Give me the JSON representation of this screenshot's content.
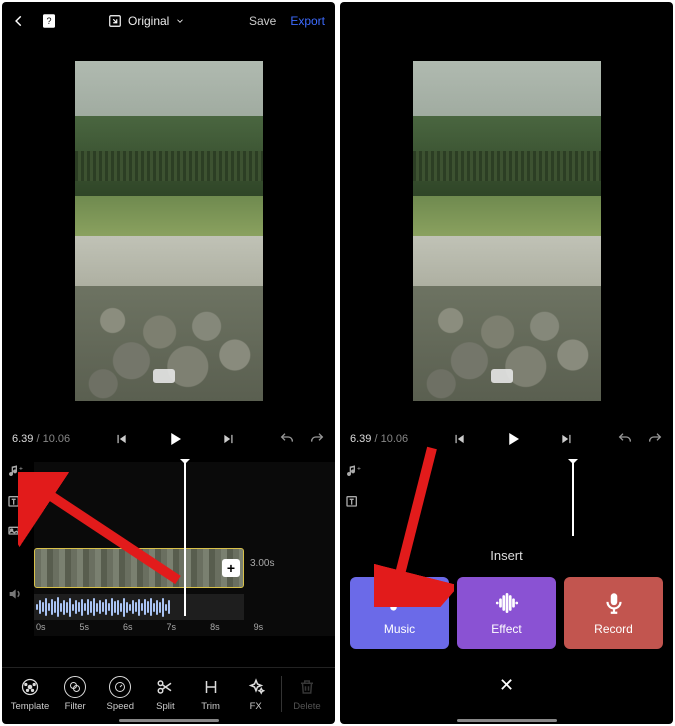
{
  "left": {
    "topbar": {
      "ratio_label": "Original",
      "save": "Save",
      "export": "Export"
    },
    "transport": {
      "current": "6.39",
      "total": "10.06"
    },
    "clip": {
      "duration": "3.00s",
      "add_label": "+"
    },
    "ruler": [
      "0s",
      "5s",
      "6s",
      "7s",
      "8s",
      "9s"
    ],
    "toolbar": {
      "template": "Template",
      "filter": "Filter",
      "speed": "Speed",
      "split": "Split",
      "trim": "Trim",
      "fx": "FX",
      "delete": "Delete"
    }
  },
  "right": {
    "transport": {
      "current": "6.39",
      "total": "10.06"
    },
    "insert": {
      "header": "Insert",
      "music": "Music",
      "effect": "Effect",
      "record": "Record",
      "close": "✕"
    }
  }
}
